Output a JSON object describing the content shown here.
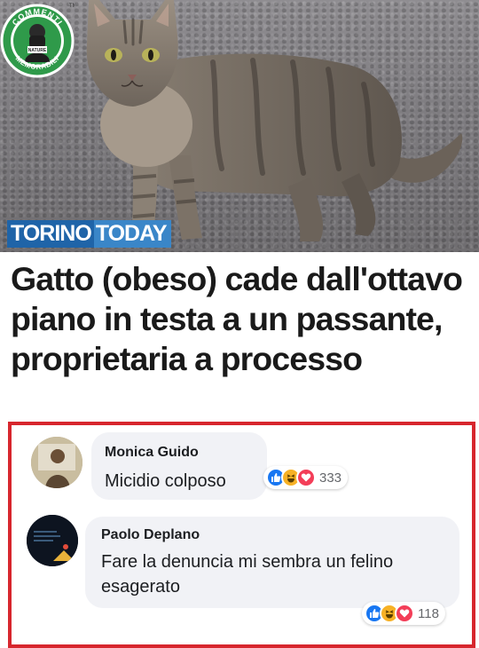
{
  "brand": {
    "part1": "TORINO",
    "part2": "TODAY"
  },
  "badge": {
    "top_text": "COMMENTI",
    "bottom_text": "MEMORABILI",
    "tm": "TM"
  },
  "headline": "Gatto (obeso) cade dall'ottavo piano in testa a un passante, proprietaria a processo",
  "comments": [
    {
      "author": "Monica Guido",
      "text": "Micidio colposo",
      "reactions": [
        "like-icon",
        "haha-icon",
        "love-icon"
      ],
      "reaction_count": "333"
    },
    {
      "author": "Paolo Deplano",
      "text": "Fare la denuncia mi sembra un felino esagerato",
      "reactions": [
        "like-icon",
        "haha-icon",
        "love-icon"
      ],
      "reaction_count": "118"
    }
  ],
  "colors": {
    "frame_border": "#d7262d",
    "like": "#1877f2",
    "haha": "#f7b125",
    "love": "#f33e58",
    "brand_dark": "#1f64a8",
    "brand_light": "#3a86c8",
    "badge_green": "#2f9a4a"
  }
}
